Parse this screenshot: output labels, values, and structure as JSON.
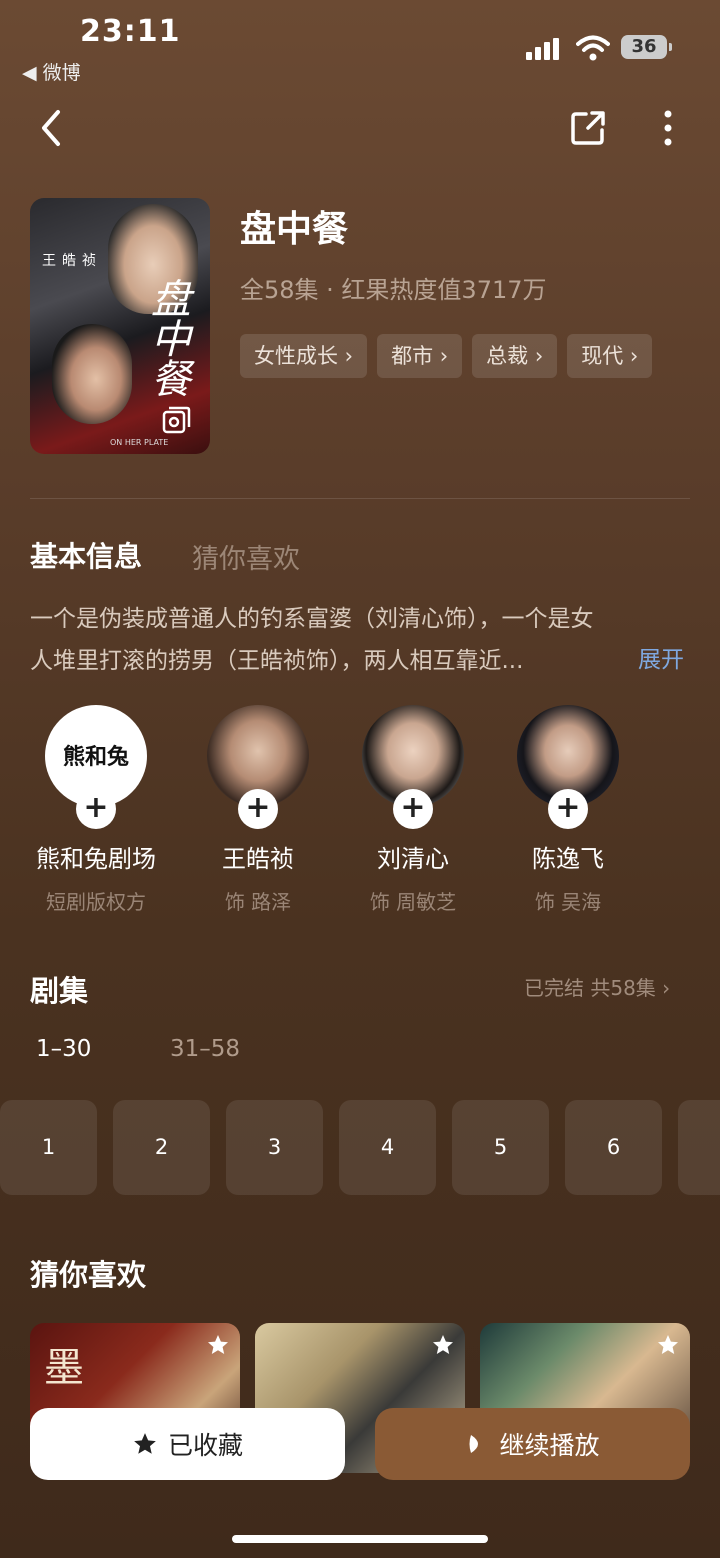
{
  "status": {
    "time": "23:11",
    "back_app": "◀ 微博",
    "battery": "36"
  },
  "show": {
    "title": "盘中餐",
    "meta": "全58集 · 红果热度值3717万",
    "poster_title": "盘中餐",
    "poster_name": "王皓祯",
    "poster_sub": "ON HER PLATE",
    "tags": [
      "女性成长 ›",
      "都市 ›",
      "总裁 ›",
      "现代 ›"
    ]
  },
  "tabs": {
    "active": "基本信息",
    "other": "猜你喜欢"
  },
  "description": {
    "line1": "一个是伪装成普通人的钓系富婆（刘清心饰），一个是女",
    "line2": "人堆里打滚的捞男（王皓祯饰），两人相互靠近...",
    "expand": "展开"
  },
  "cast": [
    {
      "name": "熊和兔剧场",
      "role": "短剧版权方",
      "logo": "熊和兔"
    },
    {
      "name": "王皓祯",
      "role": "饰 路泽"
    },
    {
      "name": "刘清心",
      "role": "饰 周敏芝"
    },
    {
      "name": "陈逸飞",
      "role": "饰 吴海"
    }
  ],
  "episodes": {
    "title": "剧集",
    "status": "已完结 共58集 ›",
    "ranges": [
      "1–30",
      "31–58"
    ],
    "items": [
      "1",
      "2",
      "3",
      "4",
      "5",
      "6"
    ]
  },
  "recommend": {
    "title": "猜你喜欢",
    "card1_text": "墨"
  },
  "buttons": {
    "favorite": "已收藏",
    "play": "继续播放"
  },
  "colors": {
    "accent_link": "#7fa8e0",
    "play_button": "#8a5a35"
  }
}
